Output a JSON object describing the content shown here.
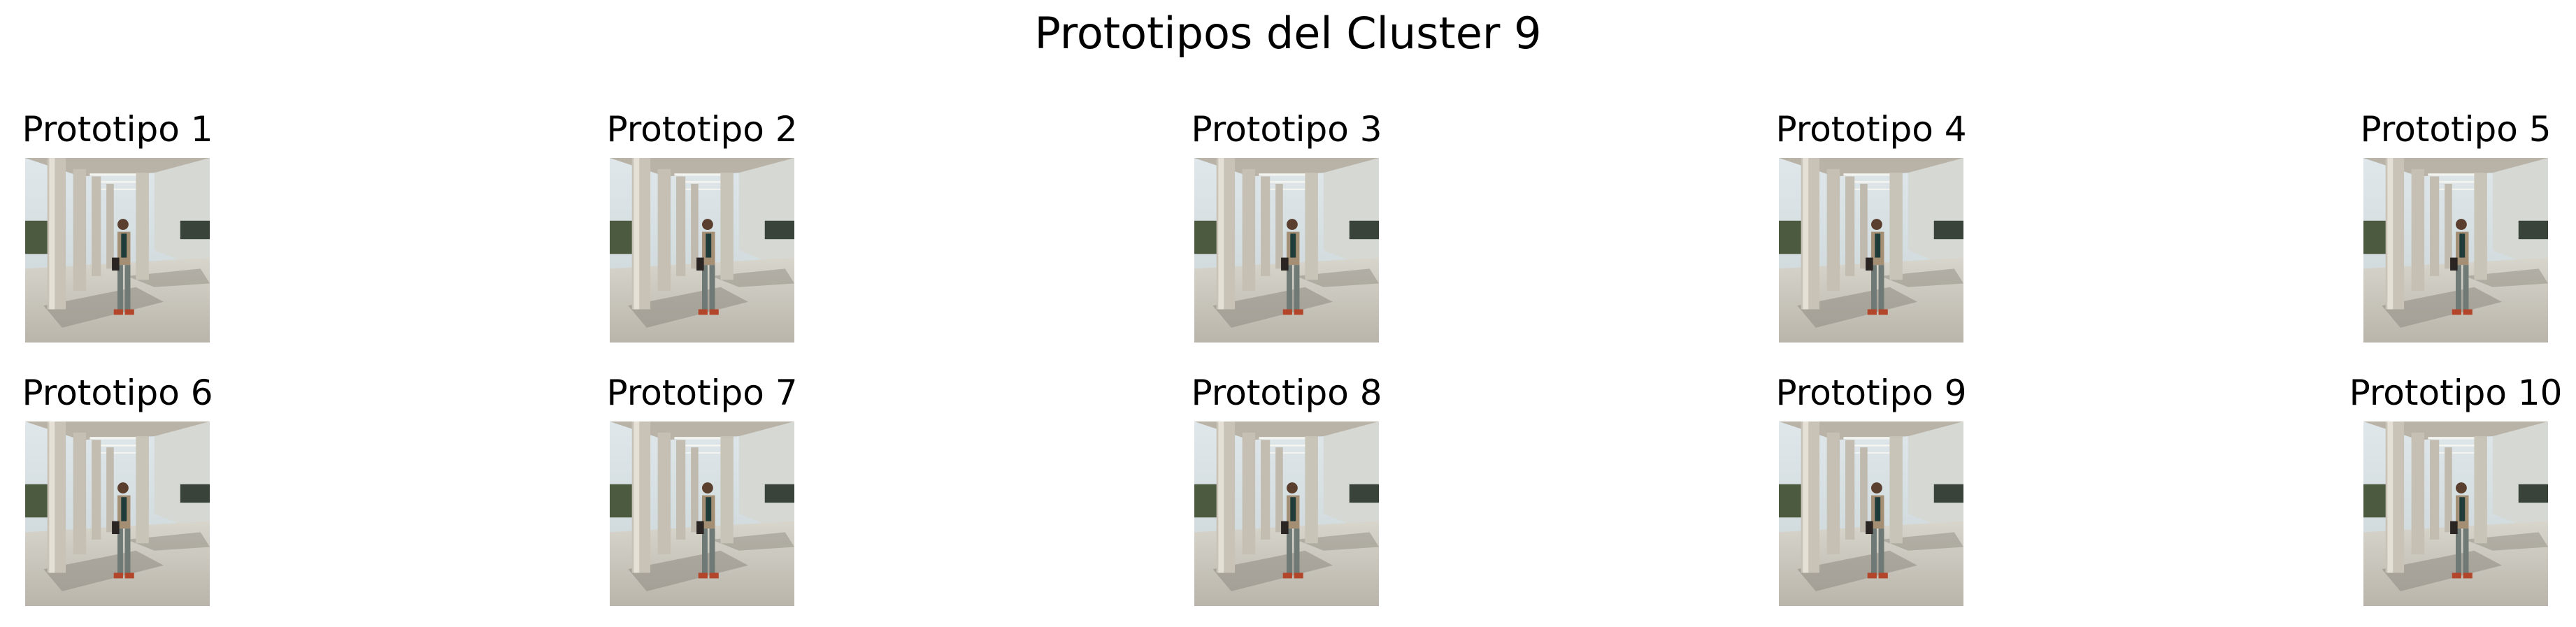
{
  "title": "Prototipos del Cluster 9",
  "prototypes": [
    {
      "label": "Prototipo 1"
    },
    {
      "label": "Prototipo 2"
    },
    {
      "label": "Prototipo 3"
    },
    {
      "label": "Prototipo 4"
    },
    {
      "label": "Prototipo 5"
    },
    {
      "label": "Prototipo 6"
    },
    {
      "label": "Prototipo 7"
    },
    {
      "label": "Prototipo 8"
    },
    {
      "label": "Prototipo 9"
    },
    {
      "label": "Prototipo 10"
    }
  ]
}
